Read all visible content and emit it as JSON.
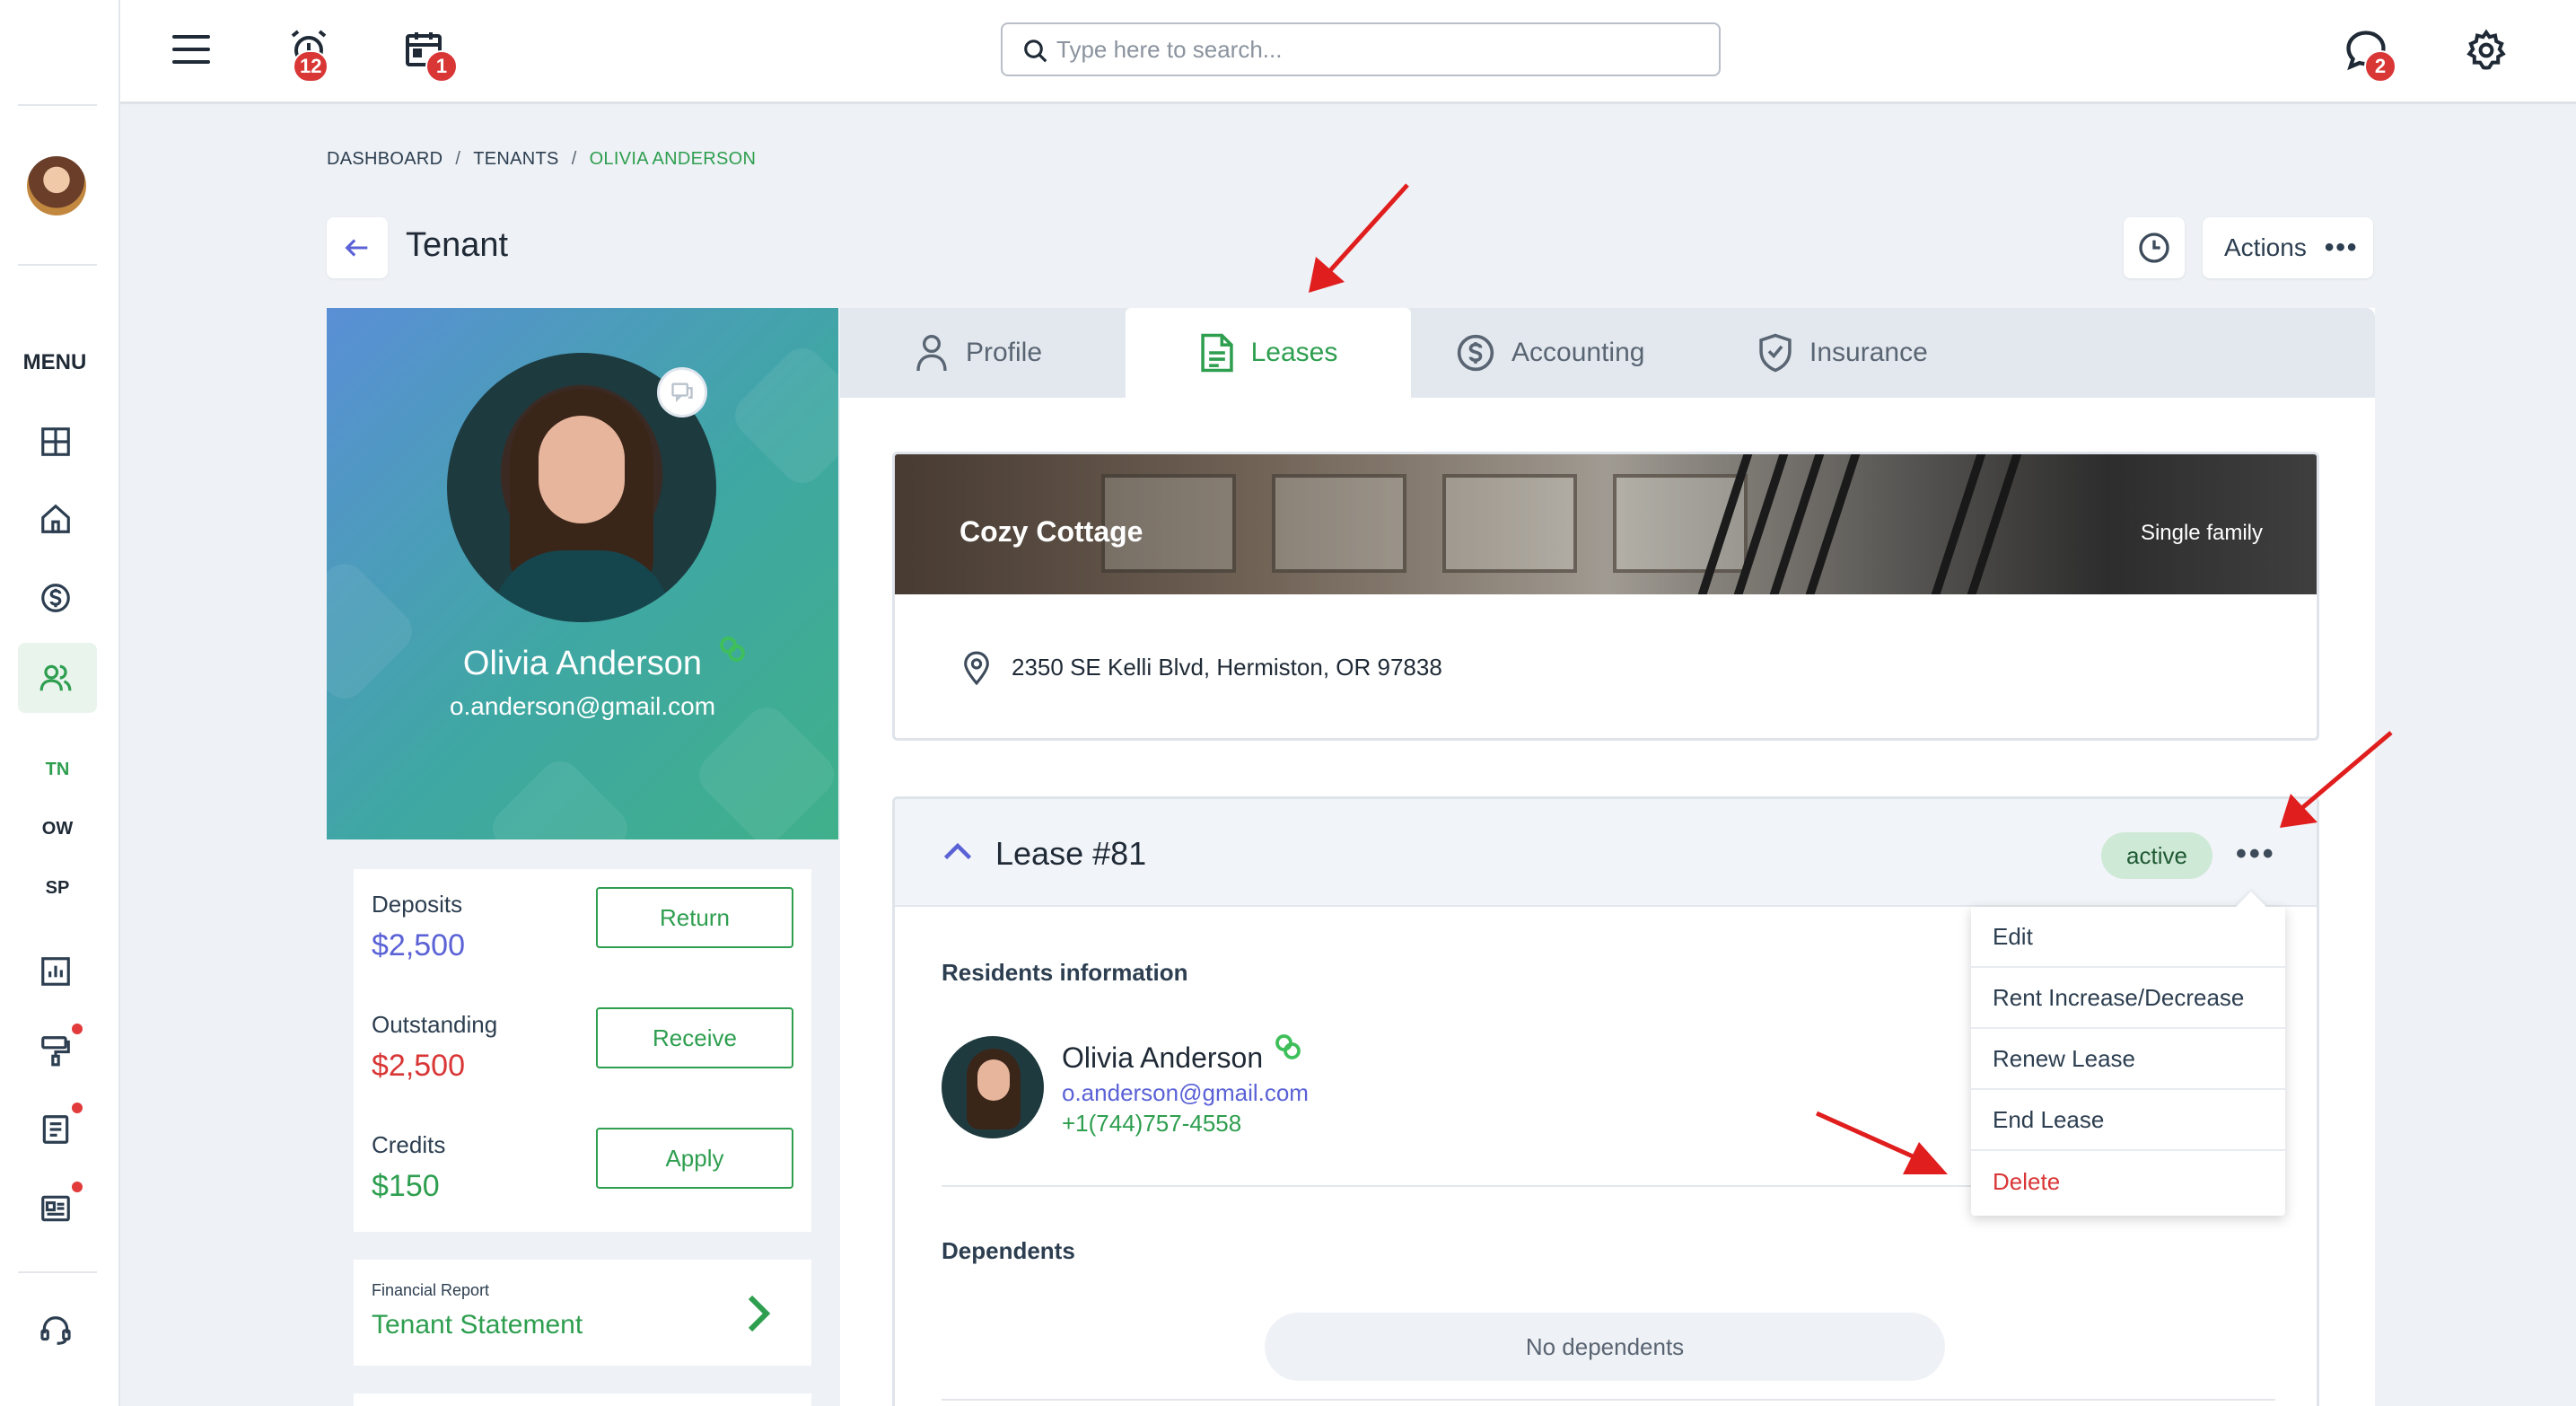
{
  "sidebar": {
    "menu_label": "MENU",
    "abbr_items": [
      "TN",
      "OW",
      "SP"
    ]
  },
  "topbar": {
    "alarm_badge": "12",
    "calendar_badge": "1",
    "chat_badge": "2",
    "search_placeholder": "Type here to search..."
  },
  "breadcrumb": {
    "items": [
      "DASHBOARD",
      "TENANTS",
      "OLIVIA ANDERSON"
    ],
    "separator": "/"
  },
  "page": {
    "title": "Tenant",
    "actions_label": "Actions"
  },
  "tenant": {
    "name": "Olivia Anderson",
    "email": "o.anderson@gmail.com",
    "phone": "+1(744)757-4558"
  },
  "balances": {
    "deposits_label": "Deposits",
    "deposits_value": "$2,500",
    "deposits_button": "Return",
    "outstanding_label": "Outstanding",
    "outstanding_value": "$2,500",
    "outstanding_button": "Receive",
    "credits_label": "Credits",
    "credits_value": "$150",
    "credits_button": "Apply"
  },
  "report": {
    "small_label": "Financial Report",
    "link_label": "Tenant Statement"
  },
  "tabs": [
    "Profile",
    "Leases",
    "Accounting",
    "Insurance"
  ],
  "active_tab": "Leases",
  "property": {
    "name": "Cozy Cottage",
    "type": "Single family",
    "address": "2350 SE Kelli Blvd, Hermiston, OR 97838"
  },
  "lease": {
    "title": "Lease #81",
    "status": "active",
    "residents_heading": "Residents information",
    "dependents_heading": "Dependents",
    "no_dependents": "No dependents"
  },
  "lease_menu": [
    "Edit",
    "Rent Increase/Decrease",
    "Renew Lease",
    "End Lease",
    "Delete"
  ],
  "colors": {
    "brand_green": "#2e9e4f",
    "danger_red": "#d93636",
    "link_blue": "#5a62d6",
    "annotation_red": "#e01e1e"
  }
}
